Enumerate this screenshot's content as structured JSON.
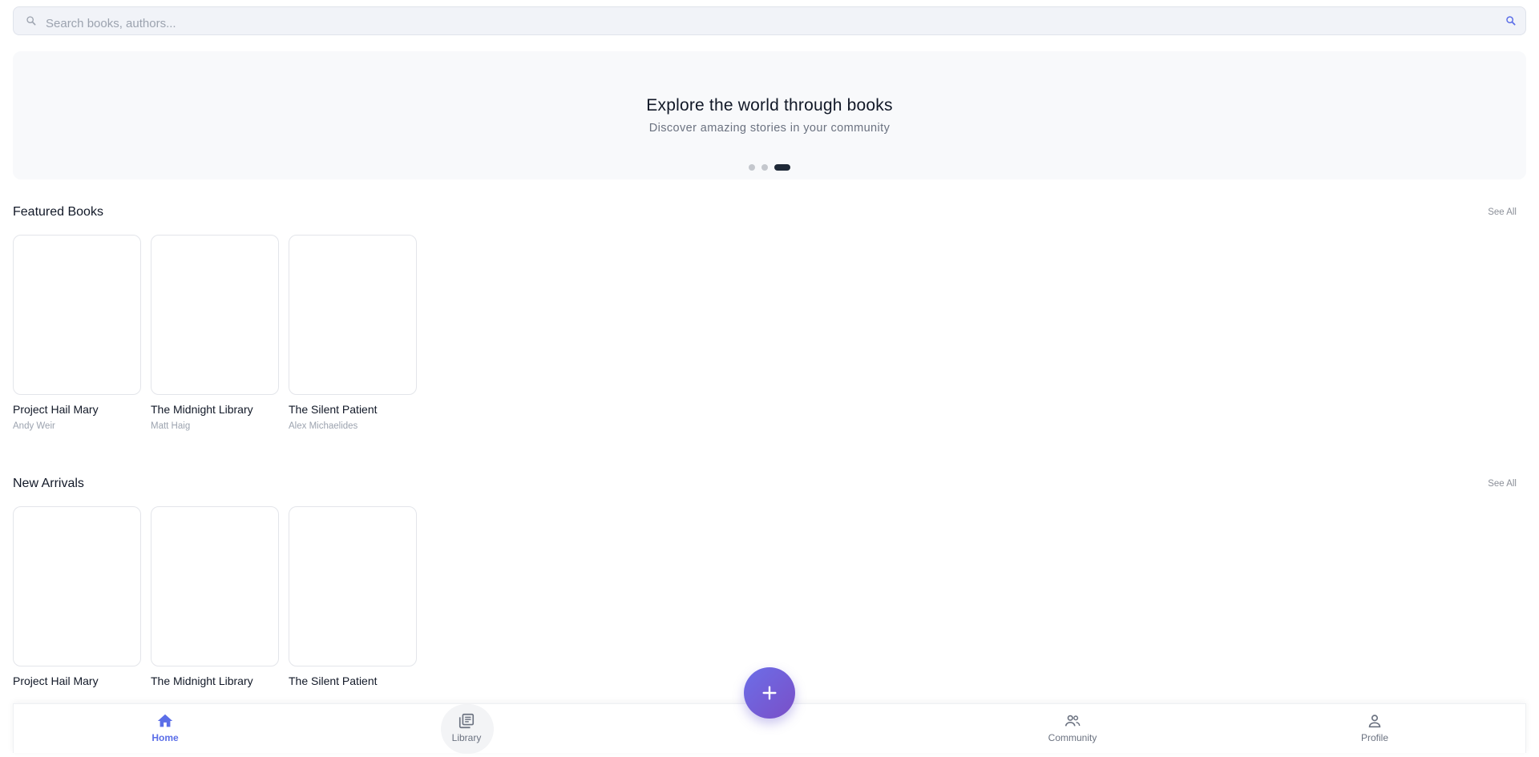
{
  "search": {
    "placeholder": "Search books, authors...",
    "value": "",
    "leading_icon": "search-icon",
    "trailing_icon": "search-submit-icon"
  },
  "hero": {
    "title": "Explore the world through books",
    "subtitle": "Discover amazing stories in your community",
    "slide_count": 3,
    "active_slide": 3
  },
  "sections": [
    {
      "title": "Featured Books",
      "see_all_label": "See All",
      "books": [
        {
          "title": "Project Hail Mary",
          "author": "Andy Weir"
        },
        {
          "title": "The Midnight Library",
          "author": "Matt Haig"
        },
        {
          "title": "The Silent Patient",
          "author": "Alex Michaelides"
        }
      ]
    },
    {
      "title": "New Arrivals",
      "see_all_label": "See All",
      "books": [
        {
          "title": "Project Hail Mary"
        },
        {
          "title": "The Midnight Library"
        },
        {
          "title": "The Silent Patient"
        }
      ]
    }
  ],
  "fab": {
    "icon": "plus-icon"
  },
  "bottom_nav": {
    "items": [
      {
        "label": "Home",
        "icon": "home-icon",
        "active": true
      },
      {
        "label": "Library",
        "icon": "library-icon",
        "active": false
      },
      {
        "label": "Community",
        "icon": "community-icon",
        "active": false
      },
      {
        "label": "Profile",
        "icon": "profile-icon",
        "active": false
      }
    ]
  },
  "colors": {
    "accent": "#5b6ee8",
    "fab_gradient_start": "#6c6ee8",
    "fab_gradient_end": "#7a4fc7",
    "text_primary": "#111827",
    "text_muted": "#9ca3af"
  }
}
